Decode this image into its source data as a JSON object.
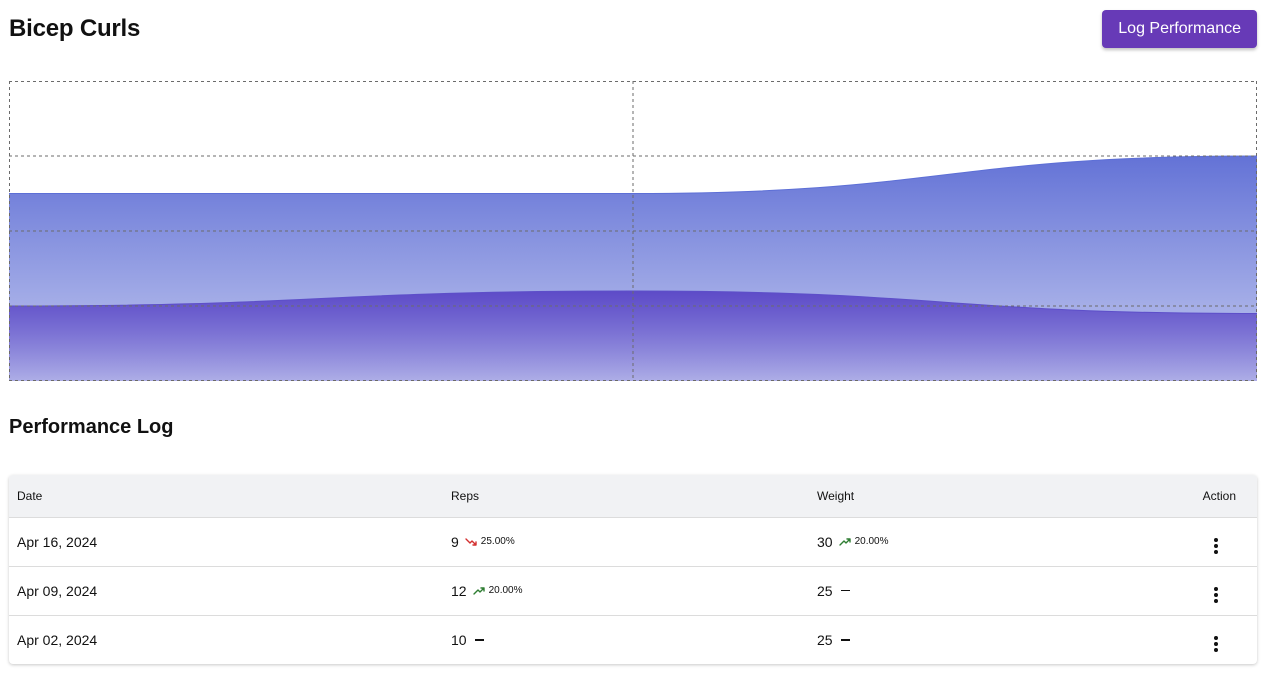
{
  "header": {
    "title": "Bicep Curls",
    "log_button_label": "Log Performance"
  },
  "colors": {
    "accent": "#673ab7",
    "weight_series": "#5d6fd6",
    "reps_series": "#5d4fc9",
    "trend_up": "#2e7d32",
    "trend_down": "#d32f2f"
  },
  "chart_data": {
    "type": "area",
    "x": [
      "Apr 02, 2024",
      "Apr 09, 2024",
      "Apr 16, 2024"
    ],
    "series": [
      {
        "values": [
          25,
          25,
          30
        ]
      },
      {
        "values": [
          10,
          12,
          9
        ]
      }
    ],
    "grid": true,
    "grid_style": "dashed",
    "axes_visible": false,
    "legend": "none"
  },
  "log": {
    "title": "Performance Log",
    "columns": [
      "Date",
      "Reps",
      "Weight",
      "Action"
    ],
    "rows": [
      {
        "date": "Apr 16, 2024",
        "reps": "9",
        "reps_trend": {
          "direction": "down",
          "percent": "25.00%",
          "icon": "trending-down-icon"
        },
        "weight": "30",
        "weight_trend": {
          "direction": "up",
          "percent": "20.00%",
          "icon": "trending-up-icon"
        }
      },
      {
        "date": "Apr 09, 2024",
        "reps": "12",
        "reps_trend": {
          "direction": "up",
          "percent": "20.00%",
          "icon": "trending-up-icon"
        },
        "weight": "25",
        "weight_trend": {
          "direction": "none"
        }
      },
      {
        "date": "Apr 02, 2024",
        "reps": "10",
        "reps_trend": {
          "direction": "none"
        },
        "weight": "25",
        "weight_trend": {
          "direction": "none"
        }
      }
    ]
  }
}
